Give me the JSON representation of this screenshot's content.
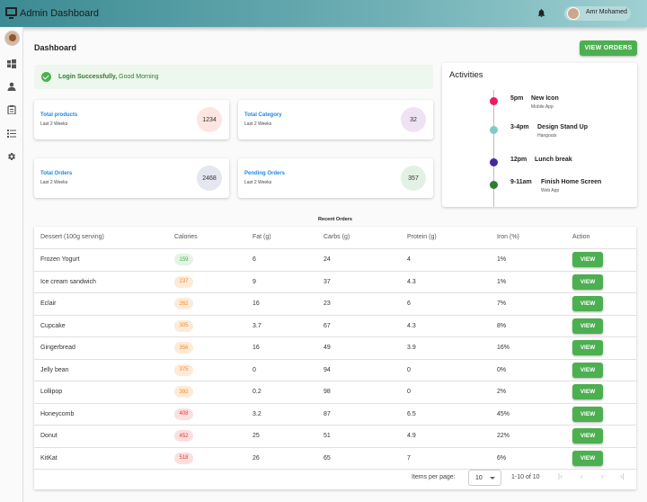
{
  "header": {
    "app_title": "Admin Dashboard",
    "user_name": "Amr Mohamed"
  },
  "page": {
    "title": "Dashboard",
    "view_orders_label": "VIEW ORDERS"
  },
  "alert": {
    "strong": "Login Successfully,",
    "text": " Good Morning"
  },
  "stats": [
    {
      "title": "Total products",
      "sub": "Last 2 Weeks",
      "value": "1234",
      "color": "#fde5e1"
    },
    {
      "title": "Total Category",
      "sub": "Last 2 Weeks",
      "value": "32",
      "color": "#efe2f3"
    },
    {
      "title": "Total Orders",
      "sub": "Last 2 Weeks",
      "value": "2468",
      "color": "#e4e6f0"
    },
    {
      "title": "Pending Orders",
      "sub": "Last 2 Weeks",
      "value": "357",
      "color": "#e3f1e5"
    }
  ],
  "activities": {
    "title": "Activities",
    "items": [
      {
        "time": "5pm",
        "title": "New Icon",
        "sub": "Mobile App",
        "color": "#e91e63"
      },
      {
        "time": "3-4pm",
        "title": "Design Stand Up",
        "sub": "Hangouts",
        "color": "#80cbc4"
      },
      {
        "time": "12pm",
        "title": "Lunch break",
        "sub": "",
        "color": "#4527a0"
      },
      {
        "time": "9-11am",
        "title": "Finish Home Screen",
        "sub": "Web App",
        "color": "#2e7d32"
      }
    ]
  },
  "orders": {
    "caption": "Recent Orders",
    "columns": [
      "Dessert (100g serving)",
      "Calories",
      "Fat (g)",
      "Carbs (g)",
      "Protein (g)",
      "Iron (%)",
      "Action"
    ],
    "view_label": "VIEW",
    "rows": [
      {
        "name": "Frozen Yogurt",
        "calories": "159",
        "fat": "6",
        "carbs": "24",
        "protein": "4",
        "iron": "1%",
        "chip": "green"
      },
      {
        "name": "Ice cream sandwich",
        "calories": "237",
        "fat": "9",
        "carbs": "37",
        "protein": "4.3",
        "iron": "1%",
        "chip": "orange"
      },
      {
        "name": "Eclair",
        "calories": "262",
        "fat": "16",
        "carbs": "23",
        "protein": "6",
        "iron": "7%",
        "chip": "orange"
      },
      {
        "name": "Cupcake",
        "calories": "305",
        "fat": "3.7",
        "carbs": "67",
        "protein": "4.3",
        "iron": "8%",
        "chip": "orange"
      },
      {
        "name": "Gingerbread",
        "calories": "356",
        "fat": "16",
        "carbs": "49",
        "protein": "3.9",
        "iron": "16%",
        "chip": "orange"
      },
      {
        "name": "Jelly bean",
        "calories": "375",
        "fat": "0",
        "carbs": "94",
        "protein": "0",
        "iron": "0%",
        "chip": "orange"
      },
      {
        "name": "Lollipop",
        "calories": "392",
        "fat": "0.2",
        "carbs": "98",
        "protein": "0",
        "iron": "2%",
        "chip": "orange"
      },
      {
        "name": "Honeycomb",
        "calories": "408",
        "fat": "3.2",
        "carbs": "87",
        "protein": "6.5",
        "iron": "45%",
        "chip": "red"
      },
      {
        "name": "Donut",
        "calories": "452",
        "fat": "25",
        "carbs": "51",
        "protein": "4.9",
        "iron": "22%",
        "chip": "red"
      },
      {
        "name": "KitKat",
        "calories": "518",
        "fat": "26",
        "carbs": "65",
        "protein": "7",
        "iron": "6%",
        "chip": "red"
      }
    ],
    "pager": {
      "items_per_page_label": "Items per page:",
      "page_size": "10",
      "range": "1-10 of 10"
    }
  },
  "sidebar_icons": [
    "avatar",
    "windows-icon",
    "person-icon",
    "clipboard-icon",
    "list-icon",
    "gear-icon"
  ]
}
